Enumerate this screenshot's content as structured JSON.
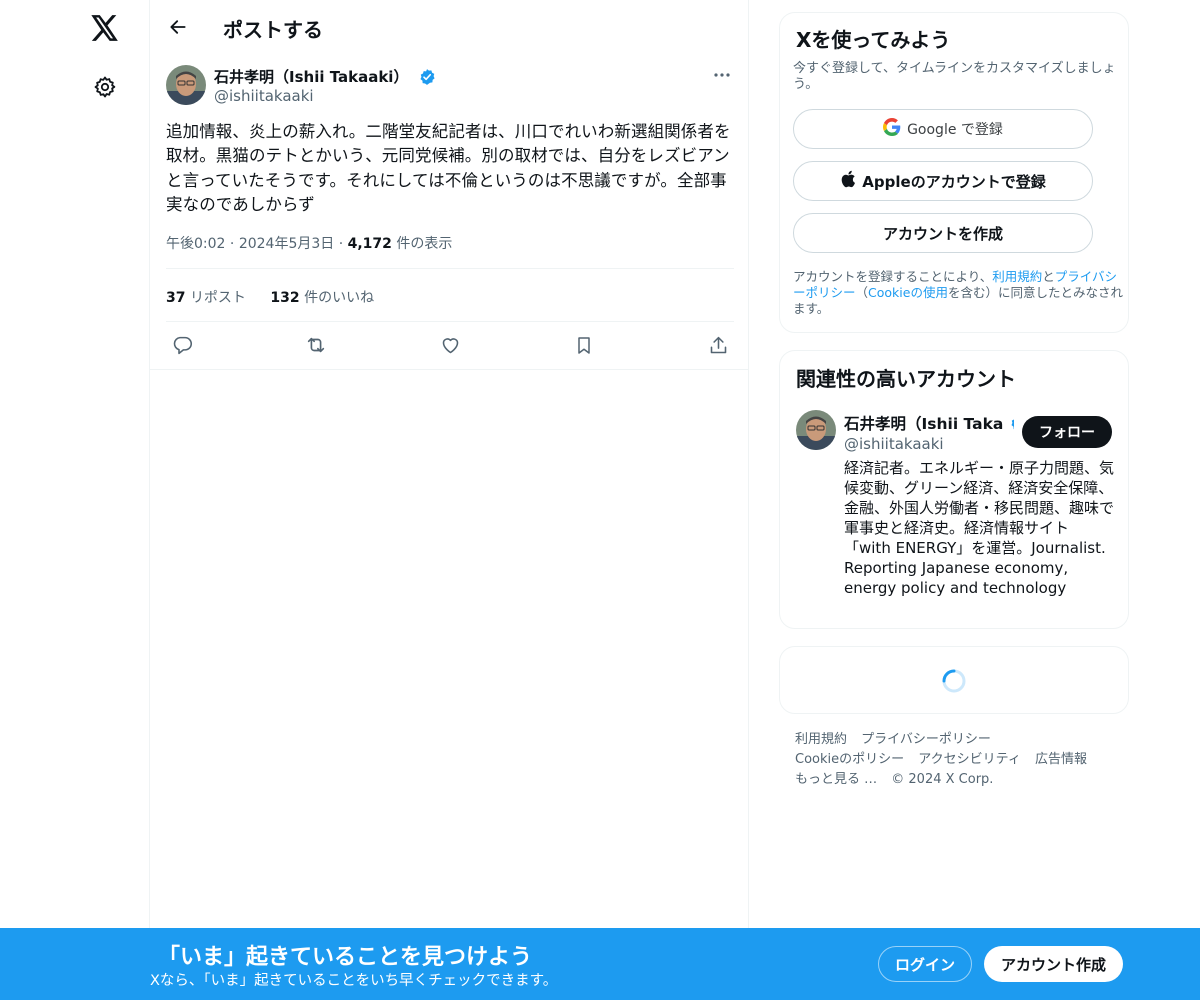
{
  "header": {
    "title": "ポストする"
  },
  "post": {
    "author_name": "石井孝明（Ishii Takaaki）",
    "author_handle": "@ishiitakaaki",
    "text": "追加情報、炎上の薪入れ。二階堂友紀記者は、川口でれいわ新選組関係者を取材。黒猫のテトとかいう、元同党候補。別の取材では、自分をレズビアンと言っていたそうです。それにしては不倫というのは不思議ですが。全部事実なのであしからず",
    "time": "午後0:02",
    "date": "2024年5月3日",
    "views_count": "4,172",
    "views_label": "件の表示",
    "reposts_count": "37",
    "reposts_label": "リポスト",
    "likes_count": "132",
    "likes_label": "件のいいね"
  },
  "signup_card": {
    "title": "Xを使ってみよう",
    "subtitle": "今すぐ登録して、タイムラインをカスタマイズしましょう。",
    "google_label": "Google で登録",
    "apple_label": "Appleのアカウントで登録",
    "create_label": "アカウントを作成",
    "legal_prefix": "アカウントを登録することにより、",
    "legal_terms": "利用規約",
    "legal_and": "と",
    "legal_privacy": "プライバシーポリシー",
    "legal_mid": "（",
    "legal_cookie": "Cookieの使用",
    "legal_suffix": "を含む）に同意したとみなされます。"
  },
  "related": {
    "title": "関連性の高いアカウント",
    "name": "石井孝明（Ishii Taka",
    "handle": "@ishiitakaaki",
    "follow_label": "フォロー",
    "bio": "経済記者。エネルギー・原子力問題、気候変動、グリーン経済、経済安全保障、金融、外国人労働者・移民問題、趣味で軍事史と経済史。経済情報サイト「with ENERGY」を運営。Journalist. Reporting Japanese economy, energy policy and technology"
  },
  "footer": {
    "links": [
      "利用規約",
      "プライバシーポリシー",
      "Cookieのポリシー",
      "アクセシビリティ",
      "広告情報",
      "もっと見る …",
      "© 2024 X Corp."
    ]
  },
  "banner": {
    "title": "「いま」起きていることを見つけよう",
    "subtitle": "Xなら、「いま」起きていることをいち早くチェックできます。",
    "login_label": "ログイン",
    "signup_label": "アカウント作成"
  },
  "colors": {
    "accent": "#1d9bf0",
    "text": "#0f1419",
    "secondary": "#536471",
    "border": "#eff3f4"
  },
  "icons": [
    "x-logo-icon",
    "gear-icon",
    "back-arrow-icon",
    "verified-badge-icon",
    "more-icon",
    "reply-icon",
    "repost-icon",
    "like-icon",
    "bookmark-icon",
    "share-icon",
    "google-icon",
    "apple-icon",
    "spinner-icon"
  ]
}
